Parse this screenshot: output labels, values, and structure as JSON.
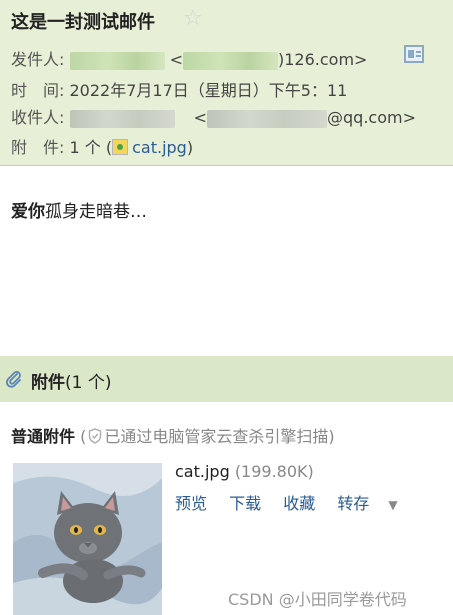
{
  "mail": {
    "subject": "这是一封测试邮件",
    "from_label": "发件人:",
    "from_open": "<",
    "from_tail": ")126.com>",
    "time_label": "时　间:",
    "time_value": "2022年7月17日（星期日）下午5：11",
    "to_label": "收件人:",
    "to_open": "<",
    "to_tail": "@qq.com>",
    "attach_label": "附　件:",
    "attach_count": "1 个 (",
    "attach_name": "cat.jpg",
    "attach_close": ")"
  },
  "body": {
    "bold_text": "爱你",
    "rest_text": "孤身走暗巷…"
  },
  "attachments": {
    "title": "附件",
    "count": "(1 个)",
    "normal_label": "普通附件",
    "scan_open": "(",
    "scan_text": "已通过电脑管家云查杀引擎扫描",
    "scan_close": ")",
    "file": {
      "name": "cat.jpg",
      "size": "(199.80K)"
    },
    "actions": {
      "preview": "预览",
      "download": "下载",
      "collect": "收藏",
      "save": "转存"
    }
  },
  "watermark": "CSDN @小田同学卷代码",
  "colors": {
    "header_bg": "#e7f0d6",
    "attach_bar_bg": "#dbe8c7",
    "link": "#2b5c95"
  },
  "icons": [
    "star-icon",
    "contact-card-icon",
    "image-file-icon",
    "paperclip-icon",
    "shield-icon",
    "caret-down-icon"
  ]
}
